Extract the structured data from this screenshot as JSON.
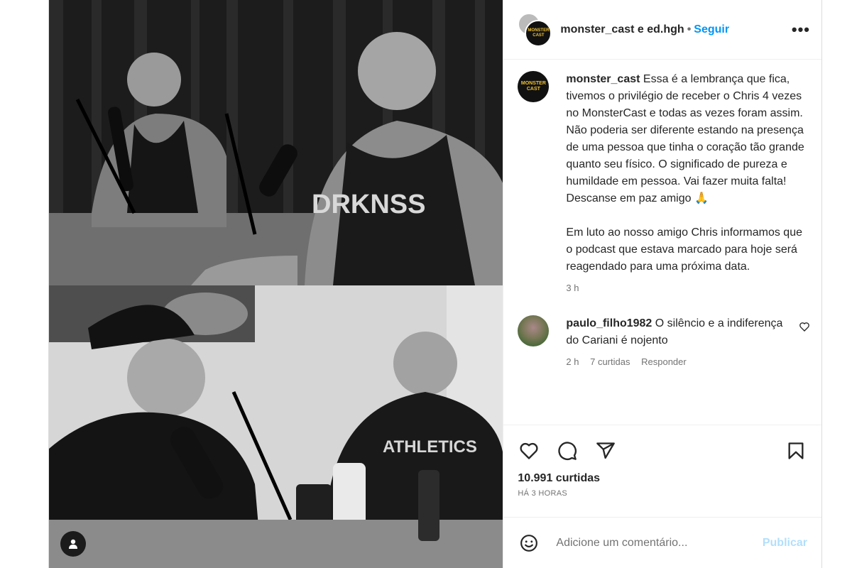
{
  "header": {
    "users": "monster_cast e ed.hgh",
    "separator": "•",
    "follow_label": "Seguir",
    "more_label": "•••"
  },
  "logo": {
    "line1": "MONSTER",
    "line2": "CAST"
  },
  "caption": {
    "username": "monster_cast",
    "text": "Essa é a lembrança que fica, tivemos o privilégio de receber o Chris 4 vezes no MonsterCast e todas as vezes foram assim. Não poderia ser diferente estando na presença de uma pessoa que tinha o coração tão grande quanto seu físico. O significado de pureza e humildade em pessoa. Vai fazer muita falta! Descanse em paz amigo 🙏\n\nEm luto ao nosso amigo Chris informamos que o podcast que estava marcado para hoje será reagendado para uma próxima data.",
    "time": "3 h"
  },
  "comments": [
    {
      "username": "paulo_filho1982",
      "text": "O silêncio e a indiferença do Cariani é nojento",
      "time": "2 h",
      "likes": "7 curtidas",
      "reply": "Responder"
    }
  ],
  "likes": "10.991 curtidas",
  "posted": "HÁ 3 HORAS",
  "comment_box": {
    "placeholder": "Adicione um comentário...",
    "publish_label": "Publicar"
  },
  "icons": [
    "heart-icon",
    "comment-icon",
    "share-icon",
    "save-icon",
    "emoji-icon",
    "user-tag-icon",
    "more-icon"
  ],
  "colors": {
    "accent": "#0095f6",
    "publish_disabled": "#b2dffc",
    "text": "#262626",
    "muted": "#737373"
  }
}
